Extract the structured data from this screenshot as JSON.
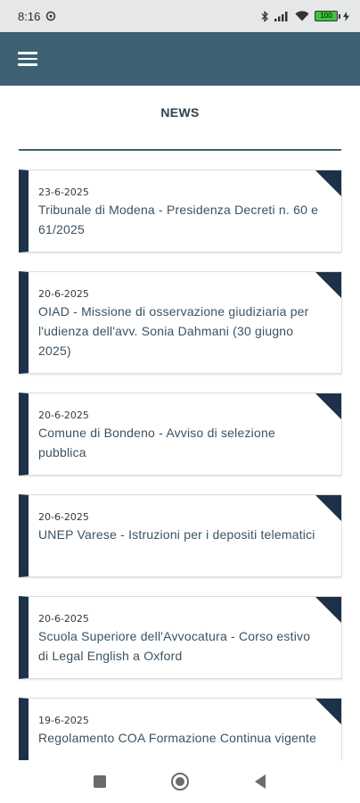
{
  "status_bar": {
    "time": "8:16",
    "battery": "100"
  },
  "header": {
    "title": "NEWS"
  },
  "news": [
    {
      "date": "23-6-2025",
      "title": "Tribunale di Modena - Presidenza Decreti n. 60 e 61/2025"
    },
    {
      "date": "20-6-2025",
      "title": "OIAD - Missione di osservazione giudiziaria per l'udienza dell'avv. Sonia Dahmani (30 giugno 2025)"
    },
    {
      "date": "20-6-2025",
      "title": "Comune di Bondeno - Avviso di selezione pubblica"
    },
    {
      "date": "20-6-2025",
      "title": "UNEP Varese - Istruzioni per i depositi telematici"
    },
    {
      "date": "20-6-2025",
      "title": "Scuola Superiore dell'Avvocatura - Corso estivo di Legal English a Oxford"
    },
    {
      "date": "19-6-2025",
      "title": "Regolamento COA Formazione Continua vigente"
    }
  ]
}
